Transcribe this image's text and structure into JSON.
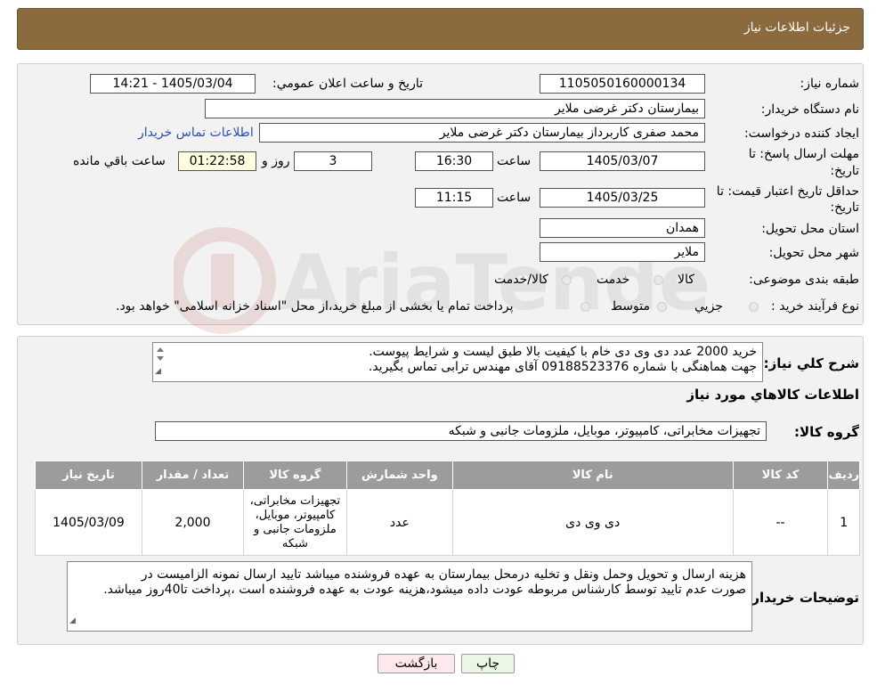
{
  "header": {
    "title": "جزئیات اطلاعات نیاز"
  },
  "watermark": {
    "text": "AriaTender.neT"
  },
  "form": {
    "need_number_label": "شماره نیاز:",
    "need_number": "1105050160000134",
    "announce_label": "تاریخ و ساعت اعلان عمومي:",
    "announce_value": "1405/03/04 - 14:21",
    "buyer_org_label": "نام دستگاه خریدار:",
    "buyer_org": "بیمارستان دکتر غرضی ملایر",
    "creator_label": "ایجاد کننده درخواست:",
    "creator": "محمد صفری کاربرداز بیمارستان دکتر غرضی ملایر",
    "contact_link": "اطلاعات تماس خریدار",
    "deadline_label_1": "مهلت ارسال پاسخ: تا",
    "deadline_label_2": "تاریخ:",
    "deadline_date": "1405/03/07",
    "time_label": "ساعت",
    "deadline_time": "16:30",
    "days_value": "3",
    "days_label": "روز و",
    "remaining_time": "01:22:58",
    "remaining_label": "ساعت باقي مانده",
    "price_validity_label_1": "حداقل تاریخ اعتبار قیمت: تا",
    "price_validity_label_2": "تاریخ:",
    "price_validity_date": "1405/03/25",
    "price_validity_time": "11:15",
    "province_label": "استان محل تحویل:",
    "province": "همدان",
    "city_label": "شهر محل تحویل:",
    "city": "ملایر",
    "category_label": "طبقه بندی موضوعی:",
    "category_options": [
      "کالا",
      "خدمت",
      "کالا/خدمت"
    ],
    "process_label": "نوع فرآیند خرید :",
    "process_options": [
      "جزیي",
      "متوسط"
    ],
    "process_note": "پرداخت تمام یا بخشی از مبلغ خرید،از محل \"اسناد خزانه اسلامی\" خواهد بود."
  },
  "details": {
    "description_label": "شرح کلي نیاز:",
    "description_line1": "خرید 2000 عدد  دی وی دی خام با کیفیت بالا طبق لیست و شرایط پیوست.",
    "description_line2": "جهت هماهنگی با شماره  09188523376 آقای مهندس ترابی تماس بگیرید.",
    "goods_info_title": "اطلاعات کالاهاي مورد نیاز",
    "goods_group_label": "گروه کالا:",
    "goods_group": "تجهیزات مخابراتی، کامپیوتر، موبایل، ملزومات جانبی و شبکه",
    "table": {
      "headers": [
        "ردیف",
        "کد کالا",
        "نام کالا",
        "واحد شمارش",
        "گروه کالا",
        "تعداد / مقدار",
        "تاریخ نیاز"
      ],
      "rows": [
        {
          "row": "1",
          "code": "--",
          "name": "دی وی دی",
          "unit": "عدد",
          "group": "تجهیزات مخابراتی، کامپیوتر، موبایل، ملزومات جانبی و شبکه",
          "quantity": "2,000",
          "date": "1405/03/09"
        }
      ]
    },
    "buyer_notes_label": "توضیحات خریدار:",
    "buyer_notes_line1": "هزینه ارسال و تحویل وحمل ونقل و تخلیه درمحل بیمارستان به عهده فروشنده میباشد تایید ارسال نمونه الزامیست در",
    "buyer_notes_line2": "صورت عدم تایید توسط کارشناس مربوطه عودت داده میشود،هزینه عودت به عهده فروشنده است ،پرداخت تا40روز میباشد."
  },
  "buttons": {
    "print": "چاپ",
    "back": "بازگشت"
  },
  "colors": {
    "header": "#8b6a3e",
    "link": "#2a4dbe",
    "table_header": "#9c9c9c",
    "back_button": "#fde9ec",
    "print_button": "#e9f7e4"
  }
}
